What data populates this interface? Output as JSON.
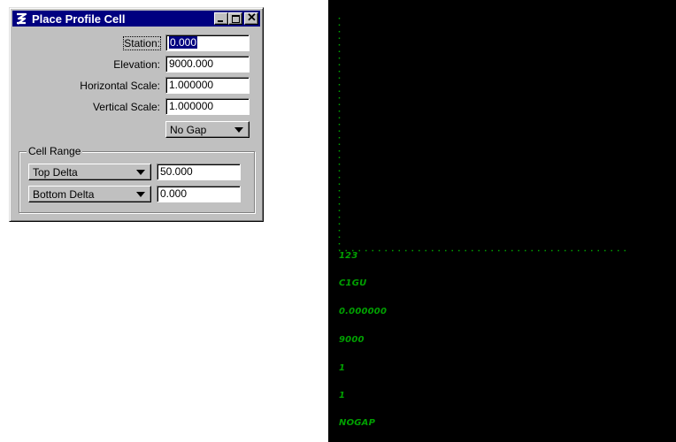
{
  "dialog": {
    "title": "Place Profile Cell",
    "fields": {
      "station": {
        "label": "Station:",
        "value": "0.000"
      },
      "elevation": {
        "label": "Elevation:",
        "value": "9000.000"
      },
      "horizontal_scale": {
        "label": "Horizontal Scale:",
        "value": "1.000000"
      },
      "vertical_scale": {
        "label": "Vertical Scale:",
        "value": "1.000000"
      }
    },
    "gap_option": "No Gap",
    "cell_range": {
      "label": "Cell Range",
      "top": {
        "option": "Top Delta",
        "value": "50.000"
      },
      "bottom": {
        "option": "Bottom Delta",
        "value": "0.000"
      }
    }
  },
  "view": {
    "background": "#000000",
    "element_color": "#00a000",
    "labels": [
      "123",
      "C1GU",
      "0.000000",
      "9000",
      "1",
      "1",
      "NOGAP"
    ]
  },
  "colors": {
    "titlebar": "#000080",
    "dialog_face": "#c0c0c0"
  }
}
